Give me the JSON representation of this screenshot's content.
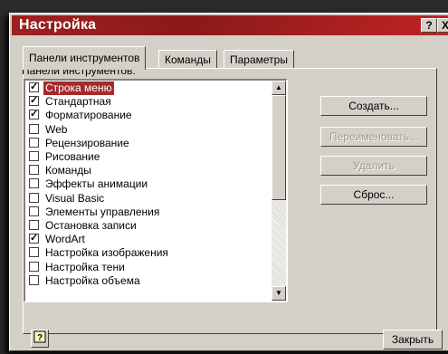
{
  "dialog": {
    "title": "Настройка",
    "help_glyph": "?",
    "close_glyph": "X"
  },
  "tabs": [
    {
      "label": "Панели инструментов",
      "active": true
    },
    {
      "label": "Команды",
      "active": false
    },
    {
      "label": "Параметры",
      "active": false
    }
  ],
  "list": {
    "label": "Панели инструментов:",
    "items": [
      {
        "label": "Строка меню",
        "checked": true,
        "selected": true
      },
      {
        "label": "Стандартная",
        "checked": true
      },
      {
        "label": "Форматирование",
        "checked": true
      },
      {
        "label": "Web",
        "checked": false
      },
      {
        "label": "Рецензирование",
        "checked": false
      },
      {
        "label": "Рисование",
        "checked": false
      },
      {
        "label": "Команды",
        "checked": false
      },
      {
        "label": "Эффекты анимации",
        "checked": false
      },
      {
        "label": "Visual Basic",
        "checked": false
      },
      {
        "label": "Элементы управления",
        "checked": false
      },
      {
        "label": "Остановка записи",
        "checked": false
      },
      {
        "label": "WordArt",
        "checked": true
      },
      {
        "label": "Настройка изображения",
        "checked": false
      },
      {
        "label": "Настройка тени",
        "checked": false
      },
      {
        "label": "Настройка объема",
        "checked": false
      }
    ]
  },
  "buttons": {
    "create": "Создать...",
    "rename": "Переименовать...",
    "delete": "Удалить",
    "reset": "Сброс...",
    "close": "Закрыть"
  },
  "colors": {
    "title_bar": "#a02020",
    "selection": "#a52a2a"
  }
}
